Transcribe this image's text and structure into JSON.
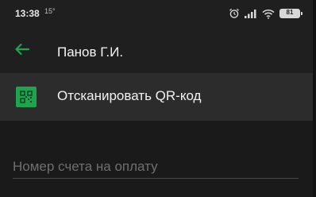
{
  "status_bar": {
    "time": "13:38",
    "temperature": "15°",
    "battery_level": "81",
    "icons": [
      "alarm-icon",
      "signal-icon",
      "wifi-icon",
      "battery-icon"
    ]
  },
  "app_bar": {
    "back_icon": "arrow-left-icon",
    "title": "Панов Г.И."
  },
  "scan_qr": {
    "icon": "qr-code-icon",
    "label": "Отсканировать QR-код"
  },
  "form": {
    "account_number": {
      "value": "",
      "placeholder": "Номер счета на оплату"
    }
  },
  "colors": {
    "accent": "#1ea44e",
    "background": "#1f1f1f",
    "row_highlight": "#2c2c2c"
  }
}
